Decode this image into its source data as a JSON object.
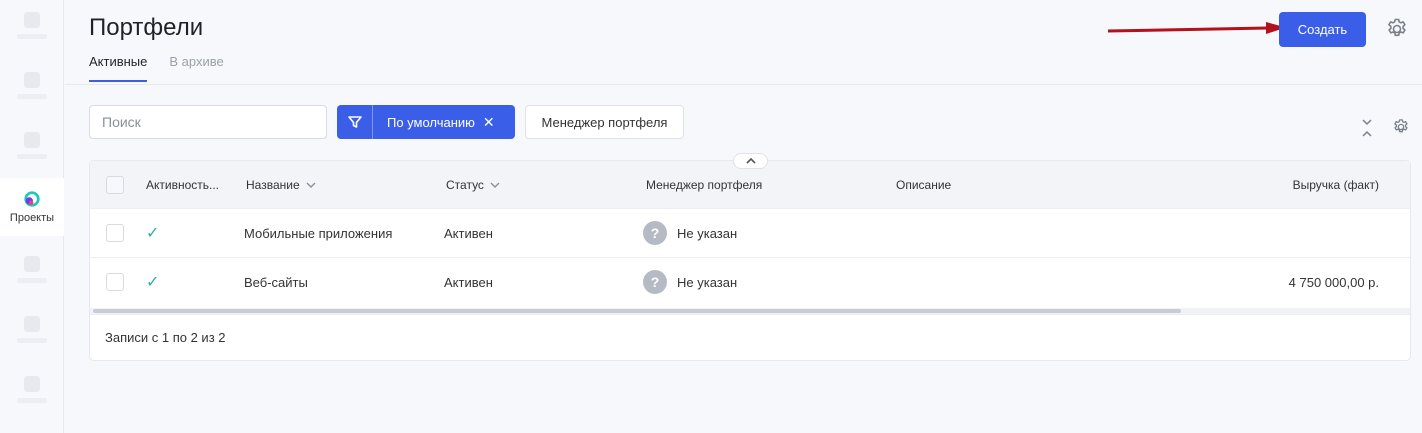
{
  "sidebar": {
    "active_item": {
      "label": "Проекты",
      "icon": "projects-logo-icon"
    },
    "colors": {
      "logo_teal": "#1fc8b4",
      "logo_purple": "#6b3df0",
      "logo_pink": "#ee3c8a"
    }
  },
  "header": {
    "title": "Портфели",
    "tabs": [
      {
        "label": "Активные",
        "active": true
      },
      {
        "label": "В архиве",
        "active": false
      }
    ],
    "create_label": "Создать"
  },
  "toolbar": {
    "search_placeholder": "Поиск",
    "filter_label": "По умолчанию",
    "filter_remove": "✕",
    "manager_chip_label": "Менеджер портфеля"
  },
  "table": {
    "columns": {
      "activity": "Активность...",
      "name": "Название",
      "status": "Статус",
      "manager": "Менеджер портфеля",
      "description": "Описание",
      "revenue": "Выручка (факт)"
    },
    "rows": [
      {
        "active": true,
        "check": "✓",
        "name": "Мобильные приложения",
        "status": "Активен",
        "avatar": "?",
        "manager": "Не указан",
        "description": "",
        "revenue": ""
      },
      {
        "active": true,
        "check": "✓",
        "name": "Веб-сайты",
        "status": "Активен",
        "avatar": "?",
        "manager": "Не указан",
        "description": "",
        "revenue": "4 750 000,00 р."
      }
    ],
    "footer": "Записи с 1 по 2 из 2"
  },
  "colors": {
    "accent": "#3a5ee8",
    "check": "#2bb3a0",
    "arrow": "#b3111b",
    "avatar_bg": "#b6bac5"
  }
}
